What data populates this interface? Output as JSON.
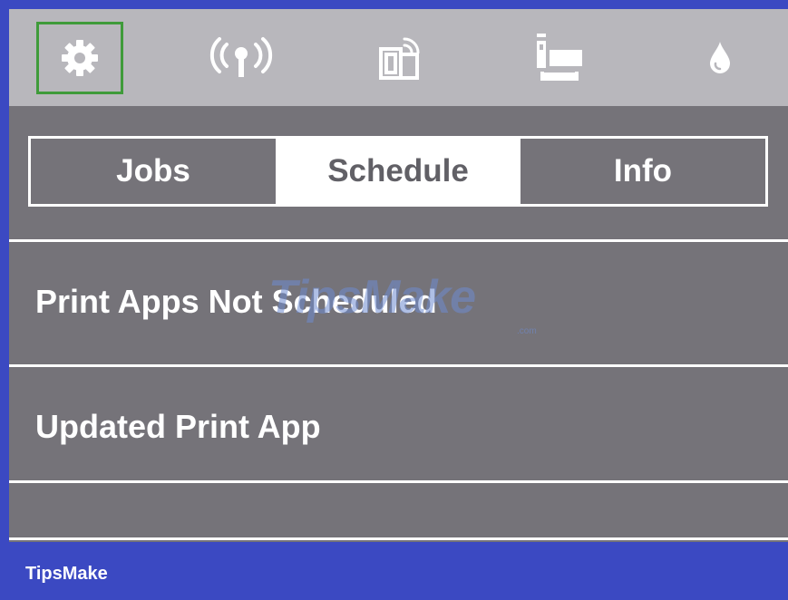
{
  "toolbar": {
    "icons": [
      {
        "name": "settings-gear-icon",
        "selected": true
      },
      {
        "name": "wireless-signal-icon"
      },
      {
        "name": "web-services-icon"
      },
      {
        "name": "printer-network-icon"
      },
      {
        "name": "ink-drop-icon"
      }
    ]
  },
  "tabs": [
    {
      "label": "Jobs",
      "active": false
    },
    {
      "label": "Schedule",
      "active": true
    },
    {
      "label": "Info",
      "active": false
    }
  ],
  "list": {
    "items": [
      {
        "label": "Print Apps Not Scheduled"
      },
      {
        "label": "Updated Print App"
      },
      {
        "label": ""
      }
    ]
  },
  "watermark": {
    "text": "TipsMake",
    "suffix": ".com"
  },
  "footer": {
    "brand": "TipsMake"
  },
  "colors": {
    "frame": "#3b49c2",
    "screen_bg": "#757379",
    "topbar_bg": "#b8b7bc",
    "selection": "#3f9b3a",
    "text": "#ffffff"
  }
}
